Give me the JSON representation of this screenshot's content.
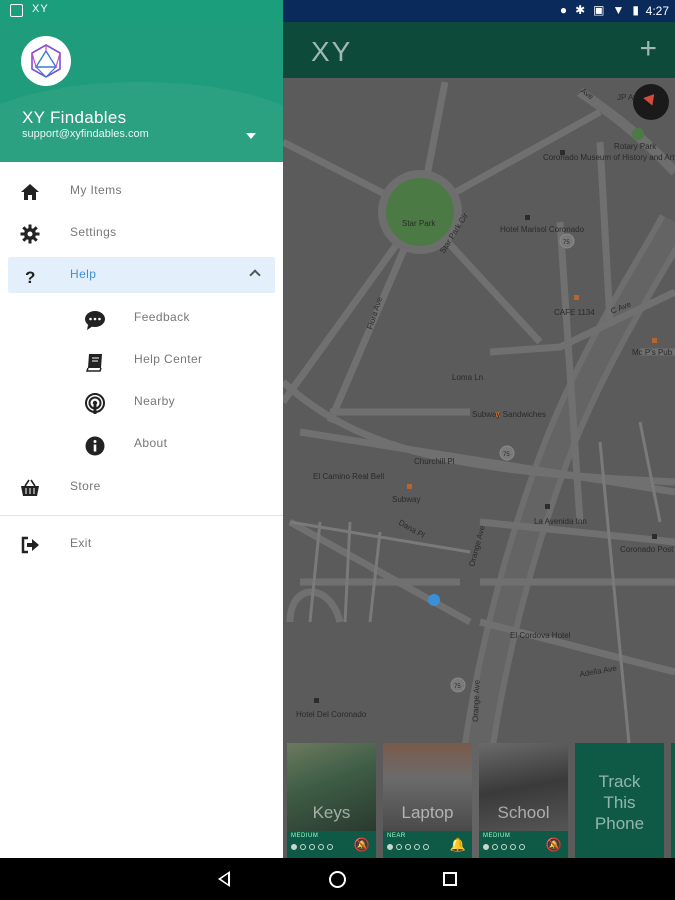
{
  "status_bar": {
    "left_label": "XY",
    "time": "4:27"
  },
  "toolbar": {
    "logo": "XY",
    "add_label": "+"
  },
  "drawer": {
    "user_name": "XY Findables",
    "user_email": "support@xyfindables.com",
    "menu": {
      "my_items": "My Items",
      "settings": "Settings",
      "help": "Help",
      "feedback": "Feedback",
      "help_center": "Help Center",
      "nearby": "Nearby",
      "about": "About",
      "store": "Store",
      "exit": "Exit"
    }
  },
  "map": {
    "labels": {
      "star_park": "Star Park",
      "star_park_cir": "Star Park Cir",
      "coronado_museum": "Coronado Museum of History and Art",
      "rotary_park": "Rotary Park",
      "hotel_marisol": "Hotel Marisol Coronado",
      "cafe_1134": "CAFE 1134",
      "c_ave": "C Ave",
      "mc_ps_pub": "Mc P's Pub",
      "loma_ln": "Loma Ln",
      "subway_sandwiches": "Subway Sandwiches",
      "churchill_pl": "Churchill Pl",
      "el_camino_real_bell": "El Camino Real Bell",
      "subway": "Subway",
      "la_avenida_inn": "La Avenida Inn",
      "coronado_post_office": "Coronado Post Office",
      "el_cordova_hotel": "El Cordova Hotel",
      "adella_ave": "Adella Ave",
      "hotel_del_coronado": "Hotel Del Coronado",
      "orange_ave": "Orange Ave",
      "flora_ave": "Flora Ave",
      "dana_pl": "Dana Pl",
      "route_75": "75",
      "jp_ave": "JP Ave",
      "museum_ave": "Ave"
    }
  },
  "cards": [
    {
      "name": "Keys",
      "signal": "MEDIUM",
      "dots_on": 1,
      "icon": "bell-off-icon"
    },
    {
      "name": "Laptop",
      "signal": "NEAR",
      "dots_on": 1,
      "icon": "bell-icon"
    },
    {
      "name": "School",
      "signal": "MEDIUM",
      "dots_on": 1,
      "icon": "bell-off-icon"
    }
  ],
  "track_card": {
    "line1": "Track",
    "line2": "This",
    "line3": "Phone"
  }
}
